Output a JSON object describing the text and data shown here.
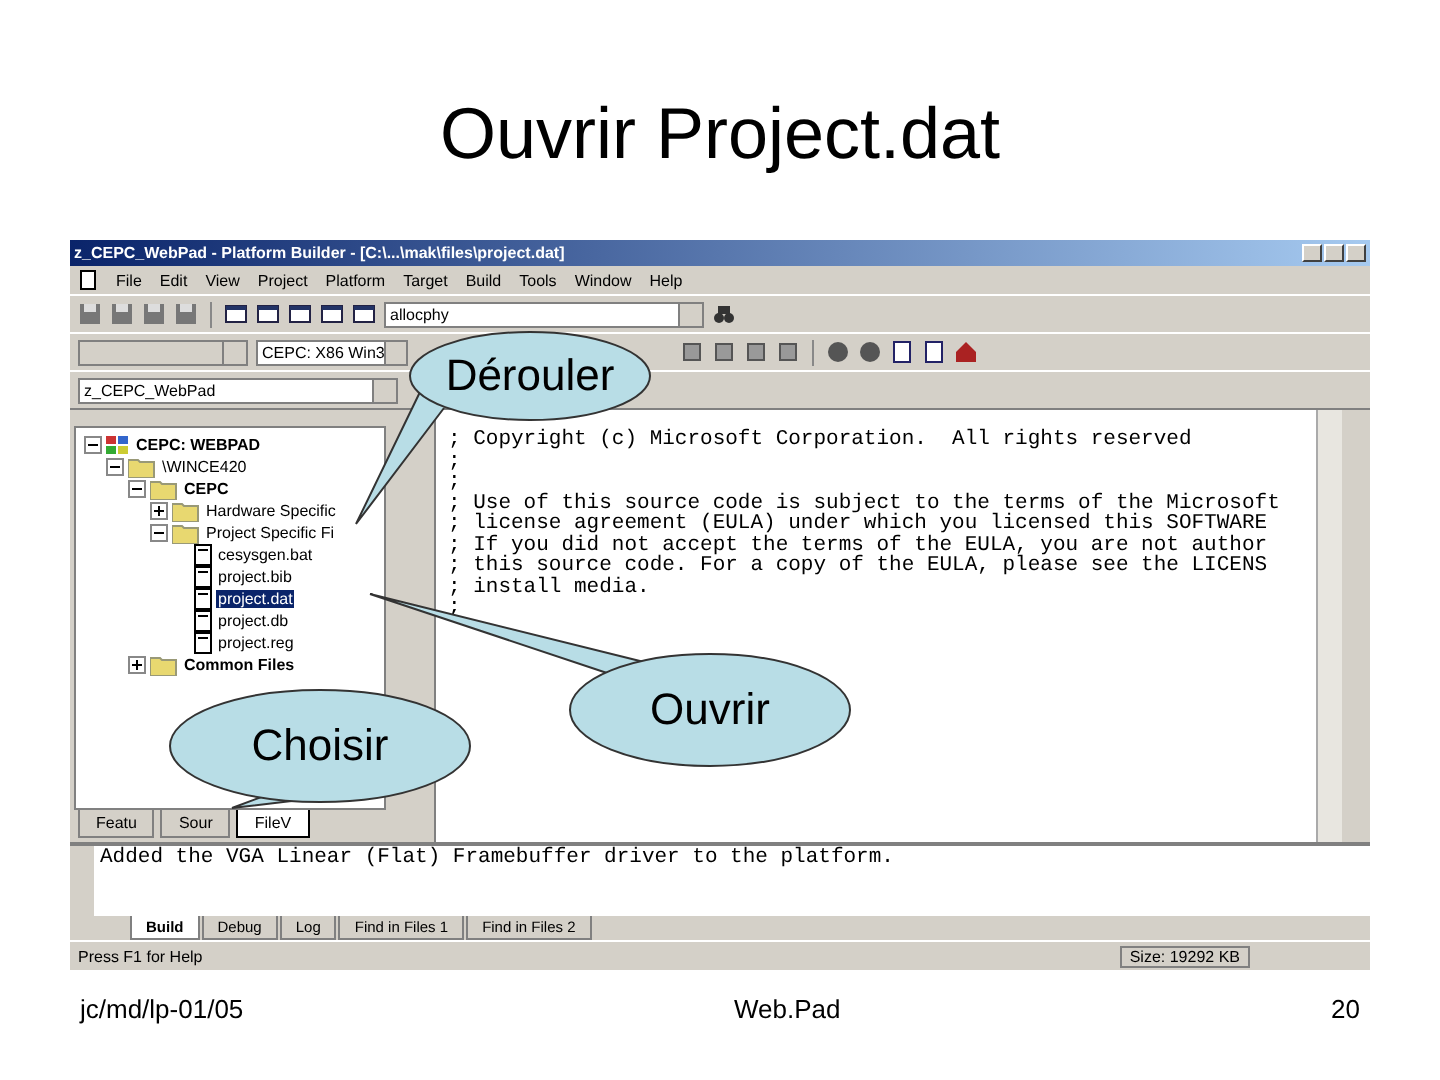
{
  "slide": {
    "title": "Ouvrir Project.dat",
    "footer_left": "jc/md/lp-01/05",
    "footer_center": "Web.Pad",
    "page_number": "20"
  },
  "window": {
    "title": "z_CEPC_WebPad - Platform Builder - [C:\\...\\mak\\files\\project.dat]"
  },
  "menu": [
    "File",
    "Edit",
    "View",
    "Project",
    "Platform",
    "Target",
    "Build",
    "Tools",
    "Window",
    "Help"
  ],
  "toolbar": {
    "search_combo": "allocphy",
    "platform_combo": "CEPC: X86 Win3",
    "workspace_combo": "z_CEPC_WebPad"
  },
  "tree": [
    {
      "label": "CEPC: WEBPAD",
      "kind": "project",
      "expanded": true,
      "selected": false,
      "children": [
        {
          "label": "\\WINCE420",
          "kind": "folder",
          "expanded": true,
          "selected": false,
          "children": [
            {
              "label": "CEPC",
              "kind": "folder",
              "expanded": true,
              "selected": false,
              "children": [
                {
                  "label": "Hardware Specific",
                  "kind": "folder",
                  "expanded": false,
                  "selected": false
                },
                {
                  "label": "Project Specific Fi",
                  "kind": "folder",
                  "expanded": true,
                  "selected": false,
                  "children": [
                    {
                      "label": "cesysgen.bat",
                      "kind": "file",
                      "selected": false
                    },
                    {
                      "label": "project.bib",
                      "kind": "file",
                      "selected": false
                    },
                    {
                      "label": "project.dat",
                      "kind": "file",
                      "selected": true
                    },
                    {
                      "label": "project.db",
                      "kind": "file",
                      "selected": false
                    },
                    {
                      "label": "project.reg",
                      "kind": "file",
                      "selected": false
                    }
                  ]
                }
              ]
            },
            {
              "label": "Common Files",
              "kind": "folder",
              "expanded": false,
              "selected": false
            }
          ]
        }
      ]
    }
  ],
  "workspace_tabs": [
    {
      "label": "Featu",
      "selected": false
    },
    {
      "label": "Sour",
      "selected": false
    },
    {
      "label": "FileV",
      "selected": true
    }
  ],
  "editor_lines": [
    "; Copyright (c) Microsoft Corporation.  All rights reserved",
    ";",
    ";",
    "; Use of this source code is subject to the terms of the Microsoft",
    "; license agreement (EULA) under which you licensed this SOFTWARE",
    "; If you did not accept the terms of the EULA, you are not author",
    "; this source code. For a copy of the EULA, please see the LICENS",
    "; install media.",
    ";"
  ],
  "output_lines": [
    "Added the VGA Linear (Flat) Framebuffer driver to the platform."
  ],
  "output_tabs": [
    {
      "label": "Build",
      "selected": true
    },
    {
      "label": "Debug",
      "selected": false
    },
    {
      "label": "Log",
      "selected": false
    },
    {
      "label": "Find in Files 1",
      "selected": false
    },
    {
      "label": "Find in Files 2",
      "selected": false
    }
  ],
  "status": {
    "text": "Press F1 for Help",
    "size": "Size: 19292 KB"
  },
  "callouts": [
    {
      "label": "Dérouler"
    },
    {
      "label": "Ouvrir"
    },
    {
      "label": "Choisir"
    }
  ]
}
